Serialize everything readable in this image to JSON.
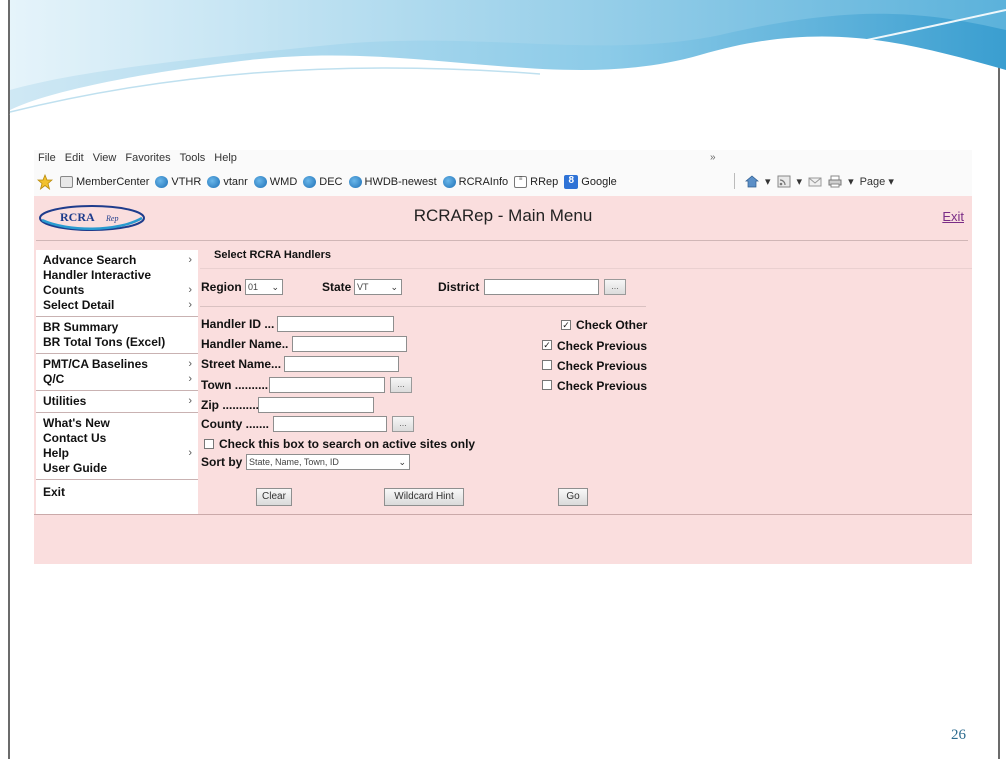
{
  "ie": {
    "menu": [
      "File",
      "Edit",
      "View",
      "Favorites",
      "Tools",
      "Help"
    ],
    "favorites": [
      {
        "label": "MemberCenter",
        "icon": "page-icon"
      },
      {
        "label": "VTHR",
        "icon": "ie-icon"
      },
      {
        "label": "vtanr",
        "icon": "ie-icon"
      },
      {
        "label": "WMD",
        "icon": "ie-icon"
      },
      {
        "label": "DEC",
        "icon": "ie-icon"
      },
      {
        "label": "HWDB-newest",
        "icon": "ie-icon"
      },
      {
        "label": "RCRAInfo",
        "icon": "ie-icon"
      },
      {
        "label": "RRep",
        "icon": "epa-icon"
      },
      {
        "label": "Google",
        "icon": "google-icon"
      }
    ],
    "more": "»",
    "page_label": "Page ▾"
  },
  "app": {
    "logo_text": "RCRA",
    "logo_sub": "Rep",
    "title": "RCRARep - Main Menu",
    "exit": "Exit",
    "sidebar": {
      "groups": [
        {
          "items": [
            {
              "label": "Advance Search",
              "chev": "›"
            },
            {
              "label": "Handler Interactive",
              "chev": ""
            },
            {
              "label": "Counts",
              "chev": "›"
            },
            {
              "label": "Select Detail",
              "chev": "›"
            }
          ]
        },
        {
          "items": [
            {
              "label": "BR Summary",
              "chev": ""
            },
            {
              "label": "BR Total Tons (Excel)",
              "chev": ""
            }
          ]
        },
        {
          "items": [
            {
              "label": "PMT/CA Baselines",
              "chev": "›"
            },
            {
              "label": "Q/C",
              "chev": "›"
            }
          ]
        },
        {
          "items": [
            {
              "label": "Utilities",
              "chev": "›"
            }
          ]
        },
        {
          "items": [
            {
              "label": "What's New",
              "chev": ""
            },
            {
              "label": "Contact Us",
              "chev": ""
            },
            {
              "label": "Help",
              "chev": "›"
            },
            {
              "label": "User Guide",
              "chev": ""
            }
          ]
        },
        {
          "items": [
            {
              "label": "Exit",
              "chev": ""
            }
          ]
        }
      ]
    },
    "form": {
      "title": "Select RCRA Handlers",
      "region_label": "Region",
      "region_value": "01",
      "state_label": "State",
      "state_value": "VT",
      "district_label": "District",
      "district_button": "...",
      "handler_id_label": "Handler ID ...",
      "handler_name_label": "Handler Name..",
      "street_label": "Street Name...",
      "town_label": "Town ..........",
      "town_button": "...",
      "zip_label": "Zip ...........",
      "county_label": "County .......",
      "county_button": "...",
      "active_sites_label": "Check this box to search on active sites only",
      "sort_label": "Sort by",
      "sort_value": "State, Name, Town, ID",
      "check_other": "Check Other",
      "check_previous": "Check Previous",
      "checks": {
        "other": true,
        "previous1": true,
        "previous2": false,
        "previous3": false,
        "active": false
      },
      "clear": "Clear",
      "wildcard": "Wildcard Hint",
      "go": "Go"
    }
  },
  "slide": {
    "number": "26"
  }
}
